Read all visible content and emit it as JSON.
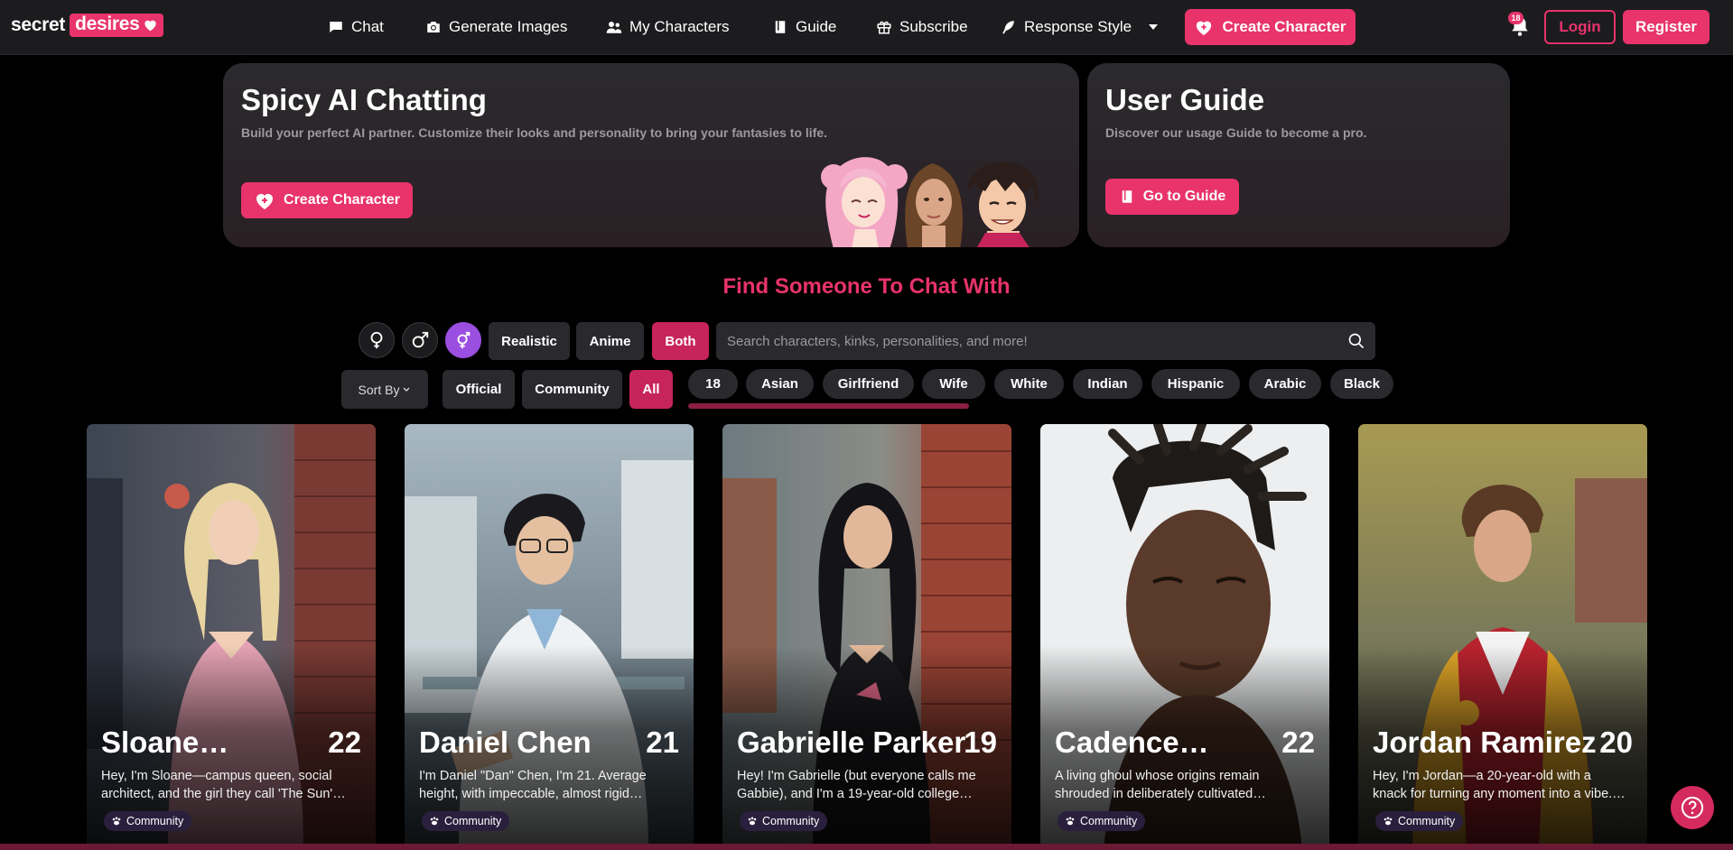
{
  "brand": {
    "part1": "secret",
    "part2": "desires",
    "accent": "#e8336b"
  },
  "nav": {
    "items": [
      {
        "label": "Chat",
        "icon": "chat-icon"
      },
      {
        "label": "Generate Images",
        "icon": "camera-icon"
      },
      {
        "label": "My Characters",
        "icon": "users-icon"
      },
      {
        "label": "Guide",
        "icon": "book-icon"
      },
      {
        "label": "Subscribe",
        "icon": "gift-icon"
      },
      {
        "label": "Response Style",
        "icon": "feather-icon"
      }
    ],
    "create_label": "Create Character",
    "bell_badge": "18",
    "login_label": "Login",
    "register_label": "Register"
  },
  "hero": {
    "chat": {
      "title": "Spicy AI Chatting",
      "subtitle": "Build your perfect AI partner. Customize their looks and personality to bring your fantasies to life.",
      "button": "Create Character"
    },
    "guide": {
      "title": "User Guide",
      "subtitle": "Discover our usage Guide to become a pro.",
      "button": "Go to Guide"
    }
  },
  "find": {
    "title": "Find Someone To Chat With",
    "styles": [
      "Realistic",
      "Anime",
      "Both"
    ],
    "style_selected": "Both",
    "search_placeholder": "Search characters, kinks, personalities, and more!",
    "sort_label": "Sort By",
    "sources": [
      "Official",
      "Community",
      "All"
    ],
    "source_selected": "All",
    "tags": [
      "18",
      "Asian",
      "Girlfriend",
      "Wife",
      "White",
      "Indian",
      "Hispanic",
      "Arabic",
      "Black"
    ]
  },
  "characters": [
    {
      "name": "Sloane…",
      "age": "22",
      "desc1": "Hey, I'm Sloane—campus queen, social",
      "desc2": "architect, and the girl they call 'The Sun'…",
      "badge": "Community"
    },
    {
      "name": "Daniel Chen",
      "age": "21",
      "desc1": "I'm Daniel \"Dan\" Chen, I'm 21. Average",
      "desc2": "height, with impeccable, almost rigid…",
      "badge": "Community"
    },
    {
      "name": "Gabrielle Parker",
      "age": "19",
      "desc1": "Hey! I'm Gabrielle (but everyone calls me",
      "desc2": "Gabbie), and I'm a 19-year-old college…",
      "badge": "Community"
    },
    {
      "name": "Cadence…",
      "age": "22",
      "desc1": "A living ghoul whose origins remain",
      "desc2": "shrouded in deliberately cultivated…",
      "badge": "Community"
    },
    {
      "name": "Jordan Ramirez",
      "age": "20",
      "desc1": "Hey, I'm Jordan—a 20-year-old with a",
      "desc2": "knack for turning any moment into a vibe.…",
      "badge": "Community"
    }
  ]
}
